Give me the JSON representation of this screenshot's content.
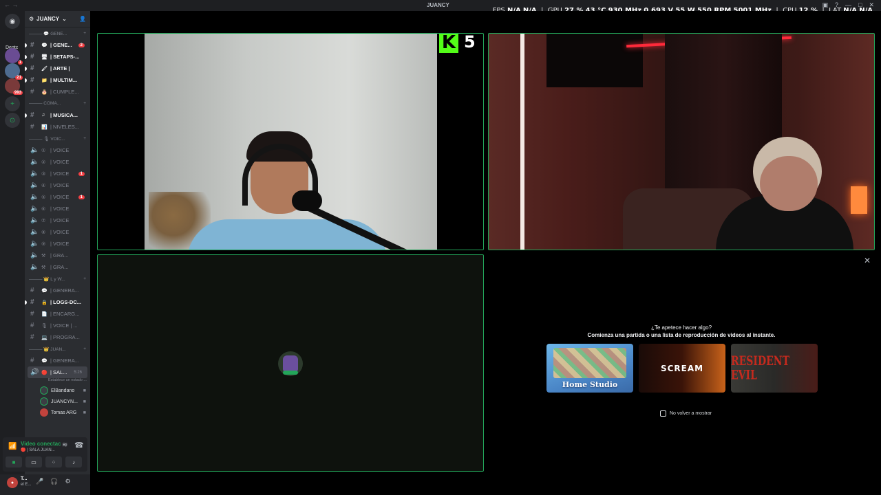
{
  "titlebar": {
    "title": "JUANCY",
    "nav": "← →"
  },
  "overlay": {
    "fps_label": "FPS",
    "fps": "N/A",
    "fps2": "N/A",
    "gpu_label": "GPU",
    "gpu_util": "27 %",
    "gpu_temp": "43 °C",
    "gpu_clock": "930 MHz",
    "gpu_volt": "0.693 V",
    "gpu_power": "55 W",
    "gpu_fan": "550 RPM",
    "gpu_mem": "5001 MHz",
    "cpu_label": "CPU",
    "cpu_util": "12 %",
    "lat_label": "LAT",
    "lat": "N/A",
    "lat2": "N/A"
  },
  "guilds": {
    "label": "Deqtc",
    "badges": [
      "1",
      "21",
      "993"
    ]
  },
  "server": {
    "name": "JUANCY"
  },
  "categories": {
    "c1": "——— 💬 GENE...",
    "c2": "——— COMA...",
    "c3": "——— 🎙 VOIC...",
    "c4": "——— 👑 L y W...",
    "c5": "——— 👑 JUAN..."
  },
  "channels": {
    "general": {
      "label": "| GENE...",
      "mention": "2"
    },
    "setups": {
      "label": "| SETAPS-..."
    },
    "arte": {
      "label": "| ARTE |"
    },
    "multim": {
      "label": "| MULTIM..."
    },
    "cumple": {
      "label": "| CUMPLE..."
    },
    "musica": {
      "label": "| MUSICA..."
    },
    "niveles": {
      "label": "| NIVELES..."
    },
    "voice1": {
      "label": "| VOICE"
    },
    "voice2": {
      "label": "| VOICE"
    },
    "voice3": {
      "label": "| VOICE",
      "mention": "1"
    },
    "voice4": {
      "label": "| VOICE"
    },
    "voice5": {
      "label": "| VOICE",
      "mention": "1"
    },
    "voice6": {
      "label": "| VOICE"
    },
    "voice7": {
      "label": "| VOICE"
    },
    "voice8": {
      "label": "| VOICE"
    },
    "voice9": {
      "label": "| VOICE"
    },
    "gra1": {
      "label": "| GRA..."
    },
    "gra2": {
      "label": "| GRA..."
    },
    "generala": {
      "label": "| GENERA..."
    },
    "logs": {
      "label": "| LOGS-DC..."
    },
    "encarg": {
      "label": "| ENCARG..."
    },
    "voicemisc": {
      "label": "| VOICE | ..."
    },
    "progra": {
      "label": "| PROGRA..."
    },
    "generalb": {
      "label": "| GENERA..."
    },
    "sala": {
      "label": "| SAL...",
      "timer": "5:26",
      "status": "Establece un estado ..."
    }
  },
  "voice_users": [
    "ElBandano",
    "JUANCYN...",
    "Tomas ARG"
  ],
  "voice_panel": {
    "title": "Video conectac",
    "subtitle": "🔴 | SALA JUAN..."
  },
  "user_panel": {
    "name": "T...",
    "status": "el E..."
  },
  "kick": {
    "count": "5"
  },
  "activity": {
    "heading": "¿Te apetece hacer algo?",
    "subheading": "Comienza una partida o una lista de reproducción de videos al instante.",
    "cards": [
      "Home Studio",
      "SCREAM",
      "RESIDENT EVIL"
    ],
    "optout": "No volver a mostrar"
  }
}
